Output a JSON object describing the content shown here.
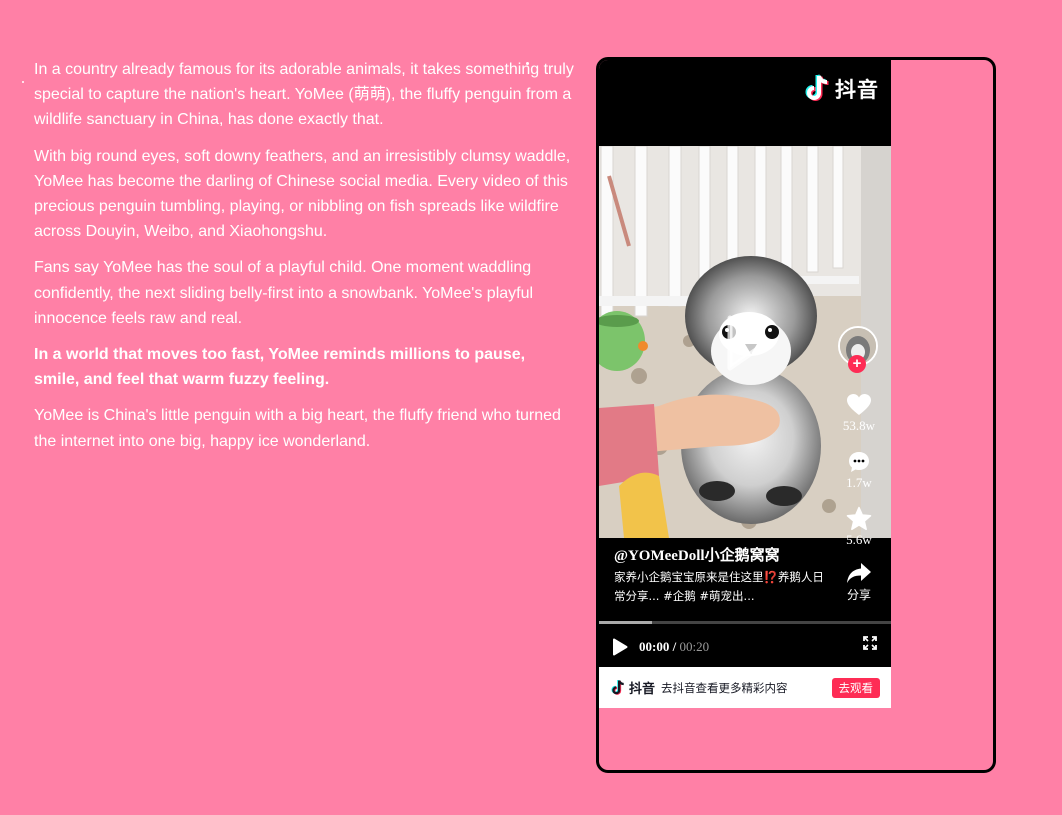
{
  "article": {
    "paragraphs": [
      "In a country already famous for its adorable animals, it takes something truly special to capture the nation's heart. YoMee (萌萌), the fluffy penguin from a wildlife sanctuary in China, has done exactly that.",
      "With big round eyes, soft downy feathers, and an irresistibly clumsy waddle, YoMee has become the darling of Chinese social media. Every video of this precious penguin tumbling, playing, or nibbling on fish spreads like wildfire across Douyin, Weibo, and Xiaohongshu.",
      "Fans say YoMee has the soul of a playful child. One moment waddling confidently, the next sliding belly-first into a snowbank. YoMee's playful innocence feels raw and real.",
      "In a world that moves too fast, YoMee reminds millions to pause, smile, and feel that warm fuzzy feeling.",
      "YoMee is China's little penguin with a big heart, the fluffy friend who turned the internet into one big, happy ice wonderland."
    ]
  },
  "player": {
    "brand": "抖音",
    "handle": "@YOMeeDoll小企鹅窝窝",
    "description": "家养小企鹅宝宝原来是住这里⁉️养鹅人日常分享... #企鹅 #萌宠出...",
    "stats": {
      "likes": "53.8w",
      "comments": "1.7w",
      "favorites": "5.6w",
      "share_label": "分享"
    },
    "time_current": "00:00",
    "time_separator": " / ",
    "time_total": "00:20",
    "progress": 0.18
  },
  "bottom_bar": {
    "brand": "抖音",
    "promo": "去抖音查看更多精彩内容",
    "watch_button": "去观看"
  },
  "colors": {
    "page_bg": "#ff80a6",
    "accent": "#fe2c55",
    "player_bg": "#000000"
  }
}
